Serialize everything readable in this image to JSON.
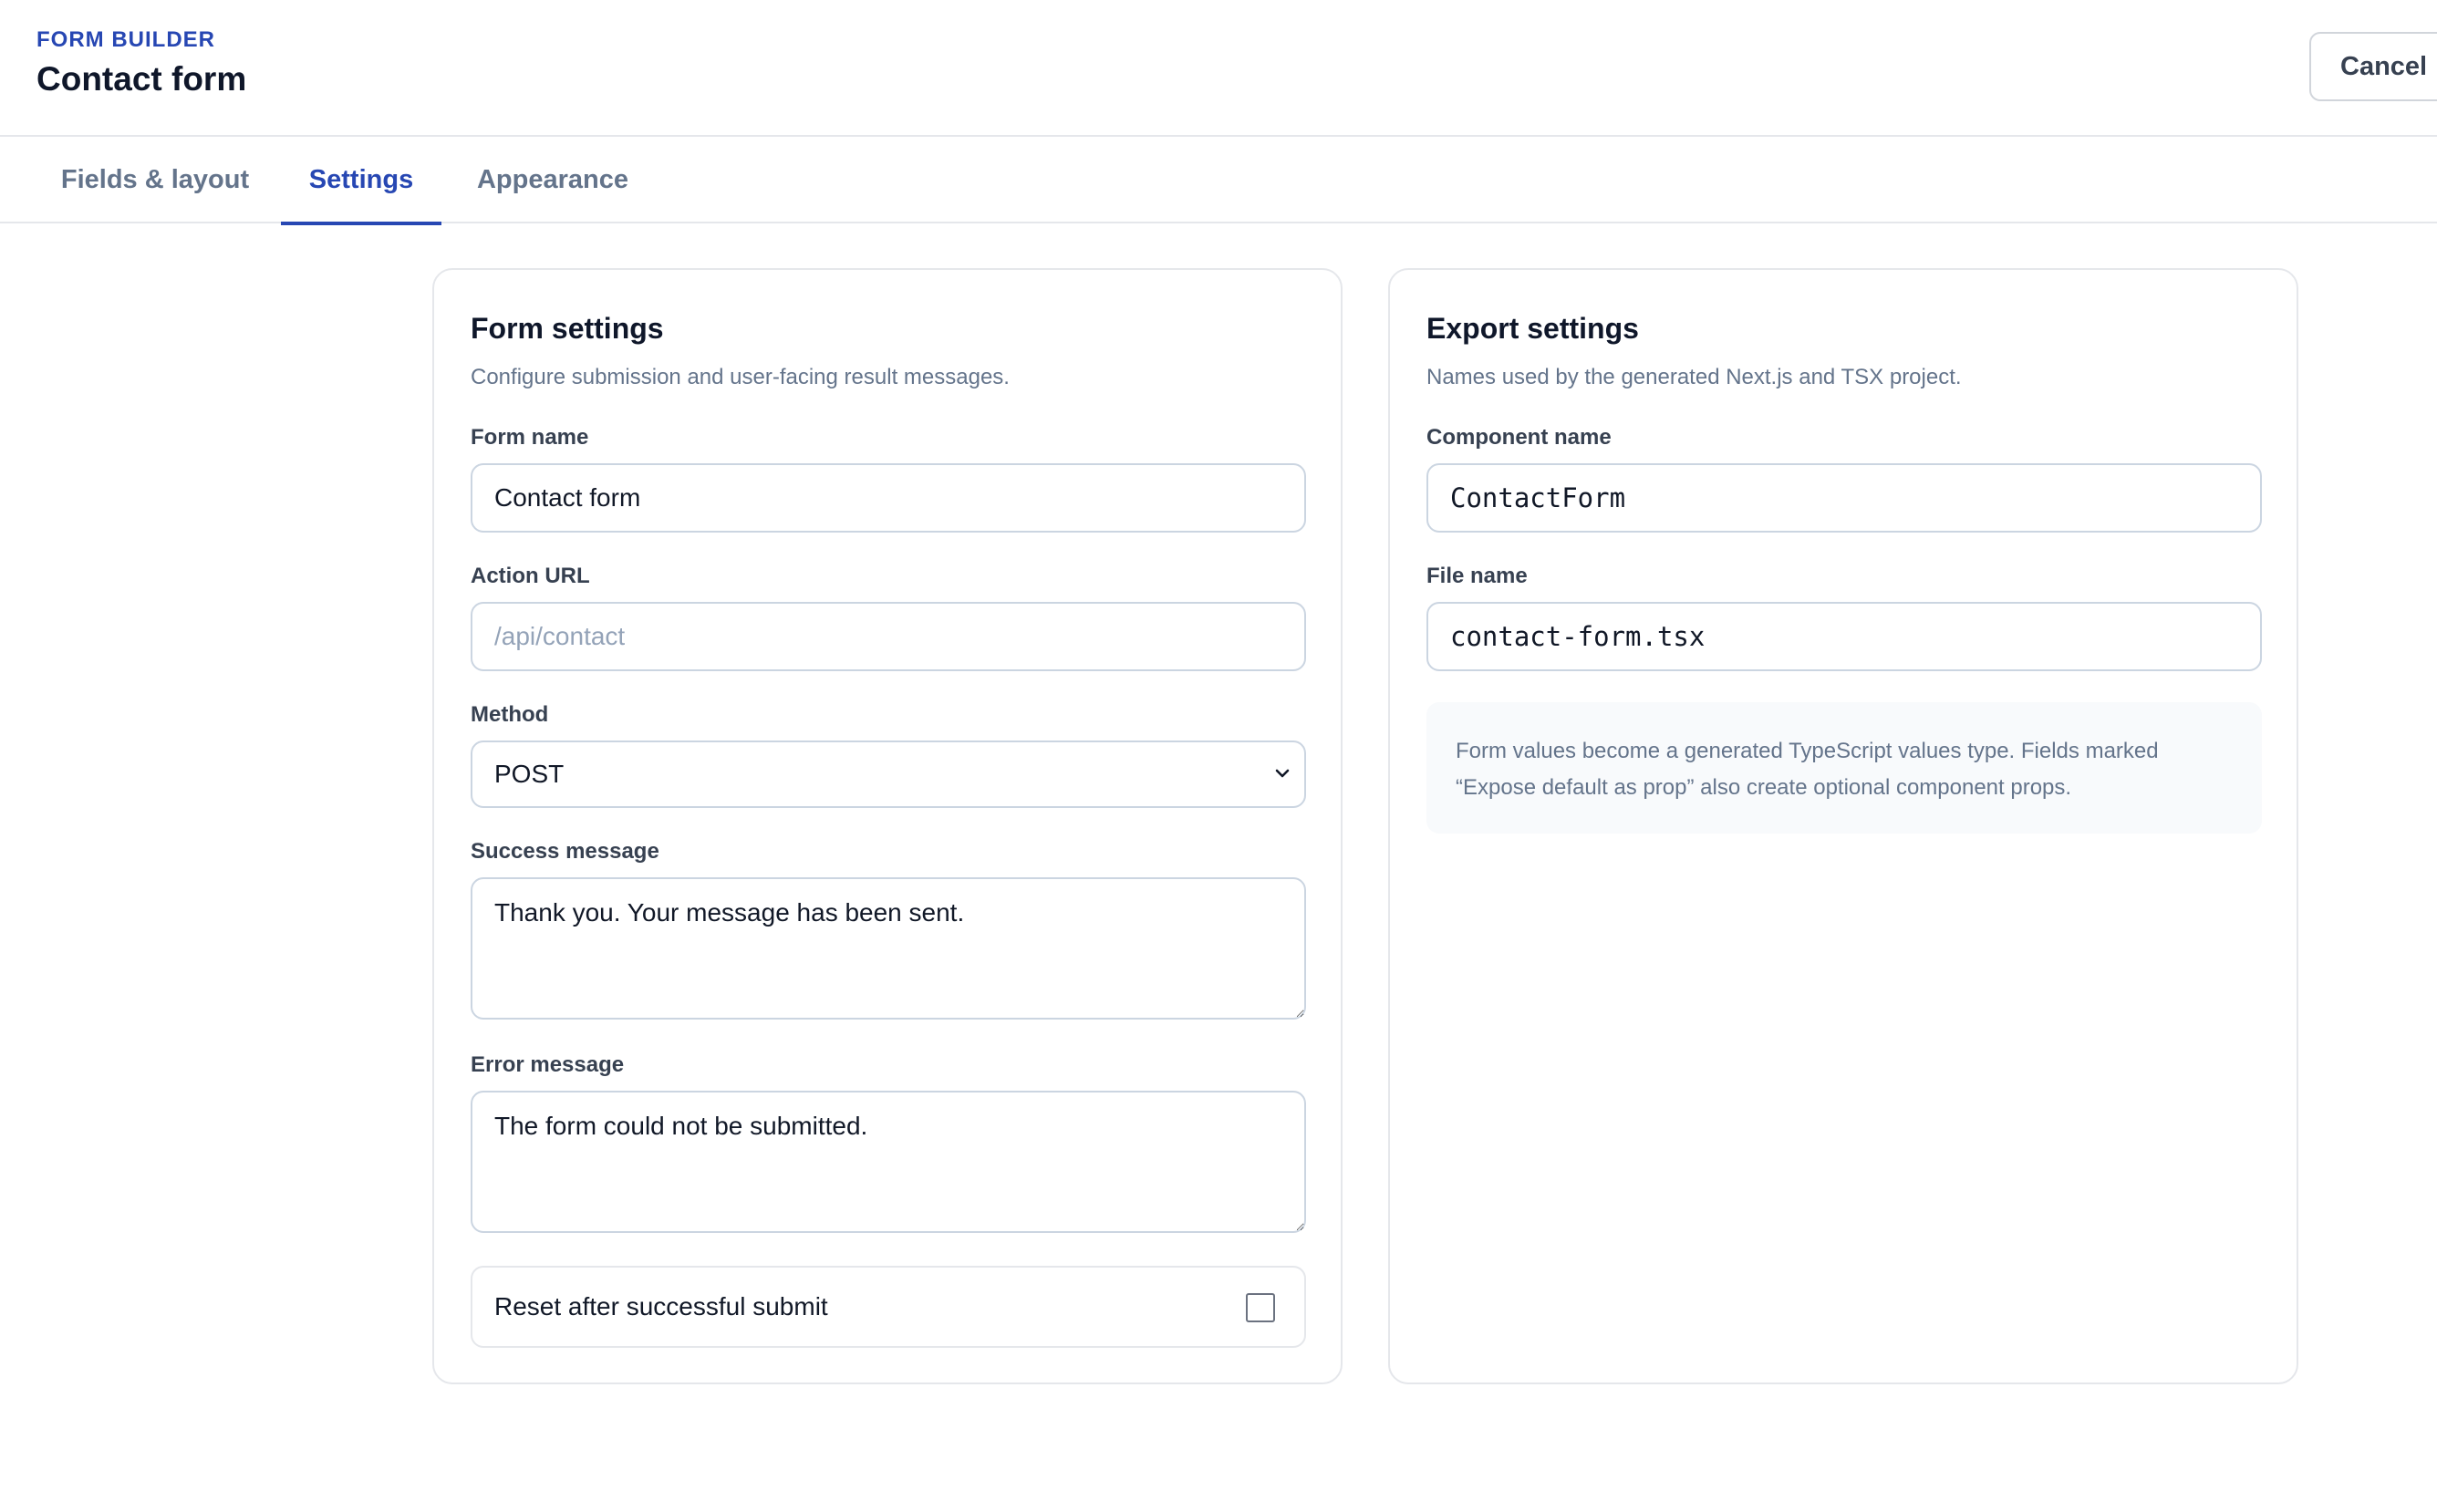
{
  "header": {
    "eyebrow": "FORM BUILDER",
    "title": "Contact form",
    "cancel_label": "Cancel"
  },
  "tabs": [
    {
      "label": "Fields & layout",
      "active": false
    },
    {
      "label": "Settings",
      "active": true
    },
    {
      "label": "Appearance",
      "active": false
    }
  ],
  "form_settings": {
    "title": "Form settings",
    "description": "Configure submission and user-facing result messages.",
    "form_name": {
      "label": "Form name",
      "value": "Contact form"
    },
    "action_url": {
      "label": "Action URL",
      "value": "",
      "placeholder": "/api/contact"
    },
    "method": {
      "label": "Method",
      "value": "POST",
      "icon": "chevron-down-icon"
    },
    "success_message": {
      "label": "Success message",
      "value": "Thank you. Your message has been sent."
    },
    "error_message": {
      "label": "Error message",
      "value": "The form could not be submitted."
    },
    "reset_after_submit": {
      "label": "Reset after successful submit",
      "checked": false
    }
  },
  "export_settings": {
    "title": "Export settings",
    "description": "Names used by the generated Next.js and TSX project.",
    "component_name": {
      "label": "Component name",
      "value": "ContactForm"
    },
    "file_name": {
      "label": "File name",
      "value": "contact-form.tsx"
    },
    "info_lines": [
      "Form values become a generated TypeScript values type. Fields marked",
      "“Expose default as prop” also create optional component props."
    ]
  },
  "colors": {
    "accent": "#2747b3",
    "border": "#e5e7eb",
    "input_border": "#cbd5e1",
    "muted_text": "#64748b"
  }
}
